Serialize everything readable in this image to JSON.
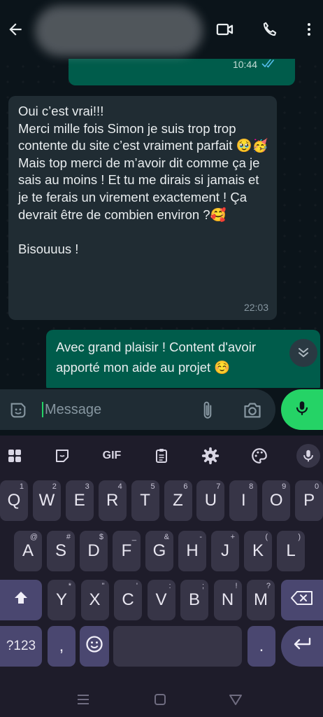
{
  "header": {
    "back_icon": "arrow-left-icon",
    "video_icon": "video-call-icon",
    "call_icon": "phone-icon",
    "menu_icon": "more-vert-icon"
  },
  "messages": {
    "top_out": {
      "time": "10:44",
      "status_icon": "double-check-blue-icon"
    },
    "incoming": {
      "text": "Oui c’est vrai!!!\nMerci mille fois Simon je suis trop trop contente du site c’est vraiment parfait 🥹🥳\nMais top merci de m’avoir dit comme ça je sais au moins ! Et tu me dirais si jamais et je te ferais un virement exactement ! Ça devrait être de combien environ ?🥰\n\nBisouuus !",
      "time": "22:03"
    },
    "outgoing": {
      "text": "Avec grand plaisir ! Content d'avoir apporté mon aide au projet ☺️"
    }
  },
  "composer": {
    "placeholder": "Message",
    "emoji_icon": "sticker-icon",
    "attach_icon": "paperclip-icon",
    "camera_icon": "camera-icon",
    "mic_icon": "mic-icon"
  },
  "keyboard": {
    "toolbar": {
      "apps_icon": "grid-icon",
      "sticker_icon": "sticker-icon",
      "gif_label": "GIF",
      "clipboard_icon": "clipboard-icon",
      "settings_icon": "gear-icon",
      "theme_icon": "palette-icon",
      "voice_icon": "mic-icon"
    },
    "row1": [
      {
        "k": "Q",
        "s": "1"
      },
      {
        "k": "W",
        "s": "2"
      },
      {
        "k": "E",
        "s": "3"
      },
      {
        "k": "R",
        "s": "4"
      },
      {
        "k": "T",
        "s": "5"
      },
      {
        "k": "Z",
        "s": "6"
      },
      {
        "k": "U",
        "s": "7"
      },
      {
        "k": "I",
        "s": "8"
      },
      {
        "k": "O",
        "s": "9"
      },
      {
        "k": "P",
        "s": "0"
      }
    ],
    "row2": [
      {
        "k": "A",
        "s": "@"
      },
      {
        "k": "S",
        "s": "#"
      },
      {
        "k": "D",
        "s": "$"
      },
      {
        "k": "F",
        "s": "_"
      },
      {
        "k": "G",
        "s": "&"
      },
      {
        "k": "H",
        "s": "-"
      },
      {
        "k": "J",
        "s": "+"
      },
      {
        "k": "K",
        "s": "("
      },
      {
        "k": "L",
        "s": ")"
      }
    ],
    "row3": [
      {
        "k": "Y",
        "s": "*"
      },
      {
        "k": "X",
        "s": "\""
      },
      {
        "k": "C",
        "s": "'"
      },
      {
        "k": "V",
        "s": ":"
      },
      {
        "k": "B",
        "s": ";"
      },
      {
        "k": "N",
        "s": "!"
      },
      {
        "k": "M",
        "s": "?"
      }
    ],
    "symbols_label": "?123",
    "comma": ",",
    "period": ".",
    "shift_icon": "shift-icon",
    "backspace_icon": "backspace-icon",
    "emoji_icon": "emoji-icon",
    "enter_icon": "enter-icon"
  },
  "navbar": {
    "recents_icon": "menu-lines-icon",
    "home_icon": "square-icon",
    "back_icon": "triangle-back-icon"
  }
}
